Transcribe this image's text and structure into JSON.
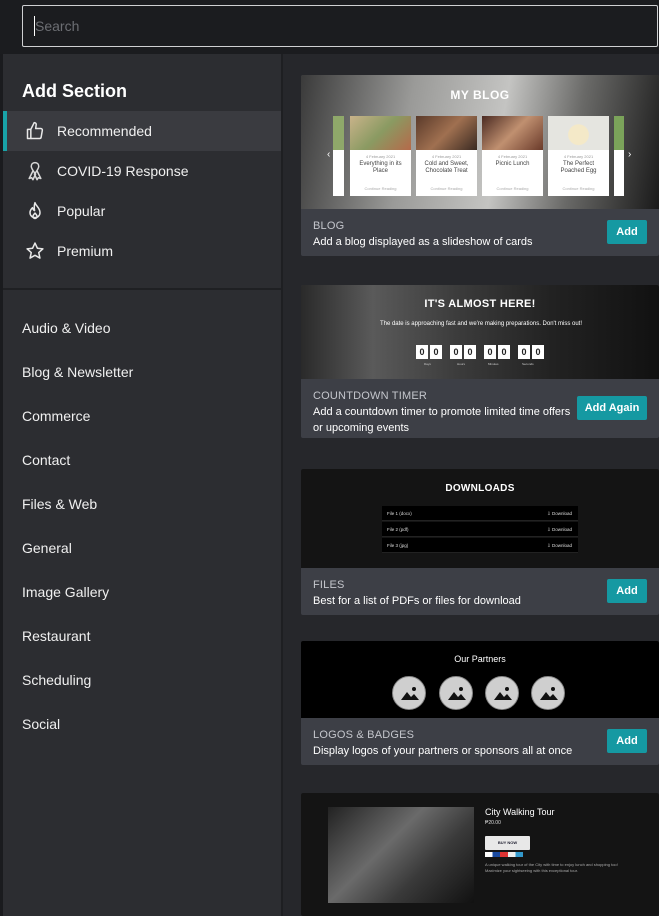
{
  "search": {
    "placeholder": "Search"
  },
  "sidebar": {
    "title": "Add Section",
    "featured": [
      {
        "label": "Recommended",
        "icon": "thumbs-up-icon",
        "active": true
      },
      {
        "label": "COVID-19 Response",
        "icon": "awareness-ribbon-icon"
      },
      {
        "label": "Popular",
        "icon": "flame-icon"
      },
      {
        "label": "Premium",
        "icon": "star-icon"
      }
    ],
    "categories": [
      "Audio & Video",
      "Blog & Newsletter",
      "Commerce",
      "Contact",
      "Files & Web",
      "General",
      "Image Gallery",
      "Restaurant",
      "Scheduling",
      "Social"
    ]
  },
  "cards": {
    "blog": {
      "preview_title": "MY BLOG",
      "posts": [
        {
          "date": "4 February 2021",
          "title": "Everything in its Place",
          "more": "Continue Reading"
        },
        {
          "date": "4 February 2021",
          "title": "Cold and Sweet, Chocolate Treat",
          "more": "Continue Reading"
        },
        {
          "date": "4 February 2021",
          "title": "Picnic Lunch",
          "more": "Continue Reading"
        },
        {
          "date": "4 February 2021",
          "title": "The Perfect Poached Egg",
          "more": "Continue Reading"
        }
      ],
      "type": "BLOG",
      "description": "Add a blog displayed as a slideshow of cards",
      "button": "Add"
    },
    "countdown": {
      "preview_title": "IT'S ALMOST HERE!",
      "preview_sub": "The date is approaching fast and we're making preparations. Don't miss out!",
      "digits": [
        "0",
        "0",
        "0",
        "0",
        "0",
        "0",
        "0",
        "0"
      ],
      "units": [
        "Days",
        "Hours",
        "Minutes",
        "Seconds"
      ],
      "type": "COUNTDOWN TIMER",
      "description": "Add a countdown timer to promote limited time offers or upcoming events",
      "button": "Add Again"
    },
    "files": {
      "preview_title": "DOWNLOADS",
      "rows": [
        {
          "name": "File 1 (docx)",
          "action": "Download"
        },
        {
          "name": "File 2 (pdf)",
          "action": "Download"
        },
        {
          "name": "File 3 (jpg)",
          "action": "Download"
        }
      ],
      "type": "FILES",
      "description": "Best for a list of PDFs or files for download",
      "button": "Add"
    },
    "logos": {
      "preview_title": "Our Partners",
      "type": "LOGOS & BADGES",
      "description": "Display logos of your partners or sponsors all at once",
      "button": "Add"
    },
    "product": {
      "title": "City Walking Tour",
      "price": "₱20.00",
      "buy": "BUY NOW",
      "desc": "A unique walking tour of the City with time to enjoy lunch and shopping too! Maximize your sightseeing with this exceptional tour."
    }
  },
  "colors": {
    "accent": "#1599a2",
    "sidebar_bg": "#2c2d31",
    "main_bg": "#26272b",
    "card_bg": "#3d3f46"
  }
}
